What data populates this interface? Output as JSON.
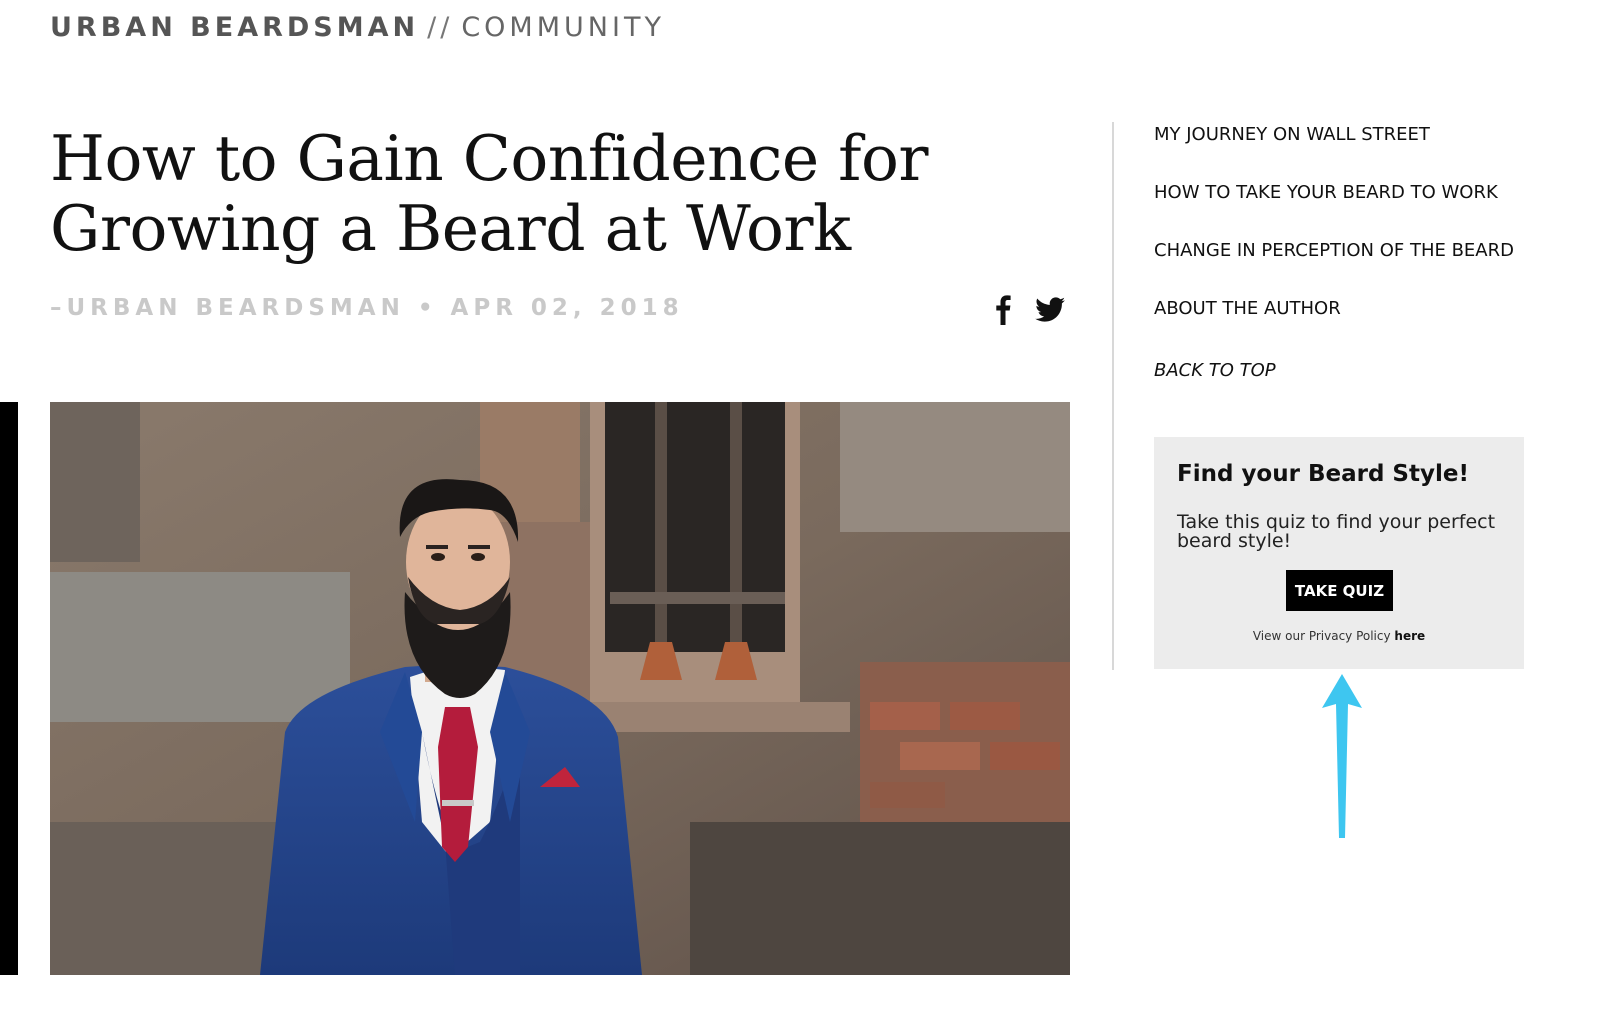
{
  "header": {
    "brand": "URBAN BEARDSMAN",
    "separator": "//",
    "section": "COMMUNITY"
  },
  "article": {
    "title": "How to Gain Confidence for Growing a Beard at Work",
    "byline": "–URBAN BEARDSMAN • APR 02, 2018",
    "share": {
      "facebook_icon": "facebook-icon",
      "twitter_icon": "twitter-icon"
    },
    "hero_image": "bearded-man-in-blue-suit-photo"
  },
  "toc": {
    "items": [
      {
        "label": "MY JOURNEY ON WALL STREET"
      },
      {
        "label": "HOW TO TAKE YOUR BEARD TO WORK"
      },
      {
        "label": "CHANGE IN PERCEPTION OF THE BEARD"
      },
      {
        "label": "ABOUT THE AUTHOR"
      }
    ],
    "back_to_top": "BACK TO TOP"
  },
  "quiz": {
    "title": "Find your Beard Style!",
    "text": "Take this quiz to find your perfect beard style!",
    "button": "TAKE QUIZ",
    "privacy_prefix": "View our Privacy Policy ",
    "privacy_link": "here"
  },
  "annotation": {
    "arrow_color": "#3ec6f0"
  },
  "colors": {
    "byline": "#c9c9c9",
    "quiz_bg": "#ececec",
    "button_bg": "#000000"
  }
}
